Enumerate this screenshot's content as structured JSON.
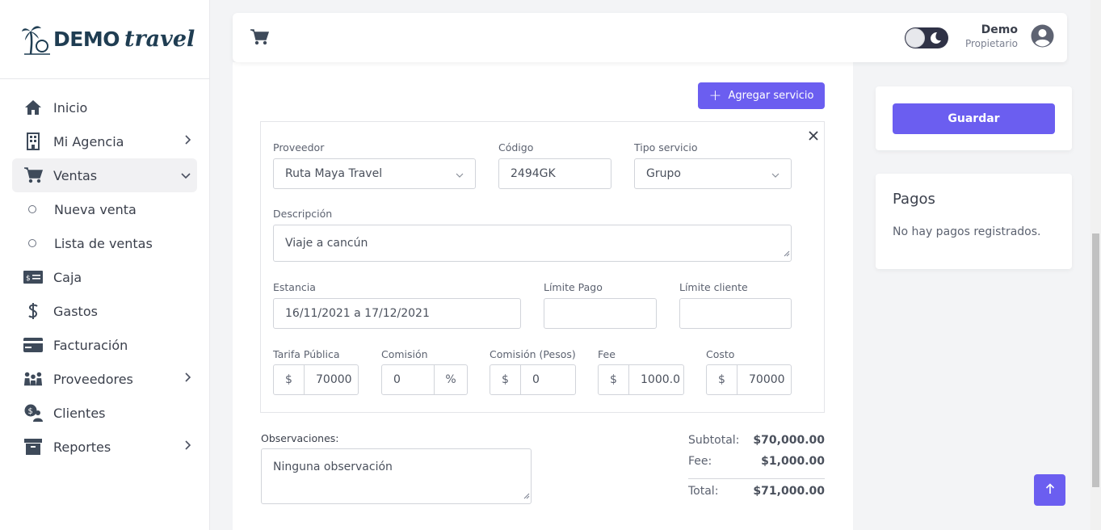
{
  "brand": {
    "demo": "DEMO",
    "travel": "travel"
  },
  "sidebar": {
    "items": [
      {
        "label": "Inicio",
        "icon": "home-icon"
      },
      {
        "label": "Mi Agencia",
        "icon": "building-icon"
      },
      {
        "label": "Ventas",
        "icon": "cart-icon"
      },
      {
        "label": "Nueva venta"
      },
      {
        "label": "Lista de ventas"
      },
      {
        "label": "Caja",
        "icon": "cash-icon"
      },
      {
        "label": "Gastos",
        "icon": "dollar-icon"
      },
      {
        "label": "Facturación",
        "icon": "credit-card-icon"
      },
      {
        "label": "Proveedores",
        "icon": "people-icon"
      },
      {
        "label": "Clientes",
        "icon": "client-icon"
      },
      {
        "label": "Reportes",
        "icon": "archive-icon"
      }
    ]
  },
  "header": {
    "user_name": "Demo",
    "user_role": "Propietario"
  },
  "main": {
    "add_service_label": "Agregar servicio",
    "service": {
      "proveedor_label": "Proveedor",
      "proveedor_value": "Ruta Maya Travel",
      "codigo_label": "Código",
      "codigo_value": "2494GK",
      "tipo_label": "Tipo servicio",
      "tipo_value": "Grupo",
      "descripcion_label": "Descripción",
      "descripcion_value": "Viaje a cancún",
      "estancia_label": "Estancia",
      "estancia_value": "16/11/2021 a 17/12/2021",
      "limite_pago_label": "Límite Pago",
      "limite_pago_value": "",
      "limite_cliente_label": "Límite cliente",
      "limite_cliente_value": "",
      "tarifa_label": "Tarifa Pública",
      "tarifa_value": "70000",
      "comision_label": "Comisión",
      "comision_value": "0",
      "comision_pesos_label": "Comisión (Pesos)",
      "comision_pesos_value": "0",
      "fee_label": "Fee",
      "fee_value": "1000.0",
      "costo_label": "Costo",
      "costo_value": "70000",
      "currency_symbol": "$",
      "percent_symbol": "%"
    },
    "observaciones_label": "Observaciones:",
    "observaciones_value": "Ninguna observación",
    "totals": {
      "subtotal_label": "Subtotal:",
      "subtotal_value": "$70,000.00",
      "fee_label": "Fee:",
      "fee_value": "$1,000.00",
      "total_label": "Total:",
      "total_value": "$71,000.00"
    }
  },
  "right": {
    "save_label": "Guardar",
    "pagos_title": "Pagos",
    "pagos_empty": "No hay pagos registrados."
  },
  "colors": {
    "accent": "#6b5ef0",
    "brand": "#1f3d52"
  }
}
